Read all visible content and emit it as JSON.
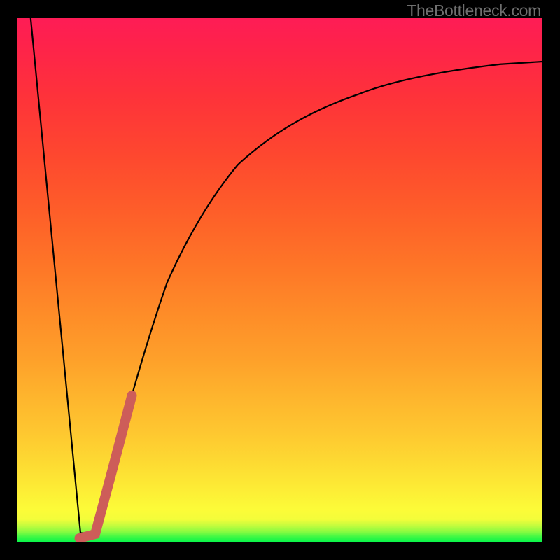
{
  "watermark": "TheBottleneck.com",
  "chart_data": {
    "type": "line",
    "title": "",
    "xlabel": "",
    "ylabel": "",
    "xlim": [
      0,
      100
    ],
    "ylim": [
      0,
      100
    ],
    "series": [
      {
        "name": "bottleneck-curve",
        "color": "#000000",
        "x": [
          2.5,
          12.0,
          14.8,
          18.0,
          21.5,
          25.0,
          28.5,
          32.5,
          37.0,
          42.0,
          48.0,
          55.0,
          63.0,
          72.0,
          82.0,
          92.0,
          100.0
        ],
        "values": [
          100.0,
          1.8,
          1.8,
          14.0,
          27.5,
          39.5,
          49.5,
          58.5,
          66.0,
          72.0,
          77.5,
          82.0,
          85.4,
          88.2,
          90.0,
          91.1,
          91.6
        ]
      },
      {
        "name": "highlight-segment",
        "color": "#cd5d59",
        "x": [
          11.8,
          14.8,
          18.2,
          21.8
        ],
        "values": [
          0.8,
          1.6,
          14.3,
          28.0
        ]
      }
    ]
  }
}
